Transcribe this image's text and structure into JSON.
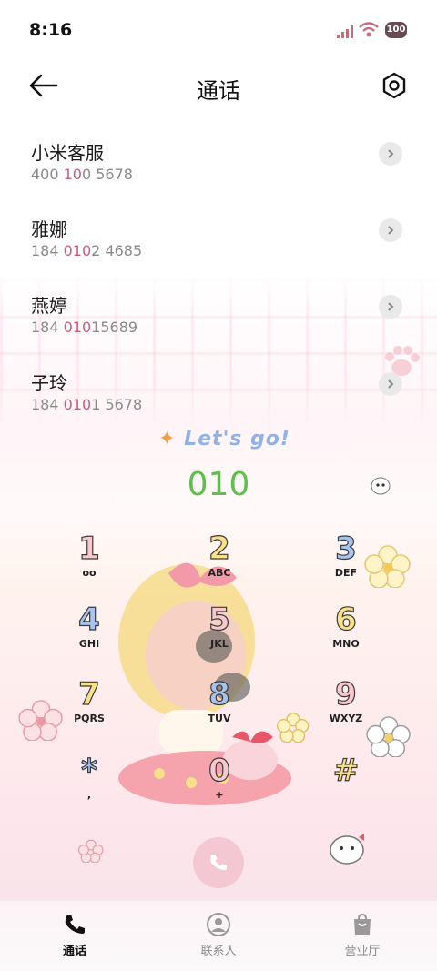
{
  "status_bar": {
    "time": "8:16",
    "battery": "100"
  },
  "header": {
    "title": "通话"
  },
  "contacts": [
    {
      "name": "小米客服",
      "num_a": "400 ",
      "num_hl": "10",
      "num_b": "0 5678"
    },
    {
      "name": "雅娜",
      "num_a": "184 ",
      "num_hl": "010",
      "num_b": "2 4685"
    },
    {
      "name": "燕婷",
      "num_a": "184 ",
      "num_hl": "010",
      "num_b": "15689"
    },
    {
      "name": "子玲",
      "num_a": "184 ",
      "num_hl": "010",
      "num_b": "1 5678"
    }
  ],
  "banner": "Let's go!",
  "dialer": {
    "input": "010"
  },
  "keypad": [
    {
      "digit": "1",
      "letters": "ᴏᴏ"
    },
    {
      "digit": "2",
      "letters": "ABC"
    },
    {
      "digit": "3",
      "letters": "DEF"
    },
    {
      "digit": "4",
      "letters": "GHI"
    },
    {
      "digit": "5",
      "letters": "JKL"
    },
    {
      "digit": "6",
      "letters": "MNO"
    },
    {
      "digit": "7",
      "letters": "PQRS"
    },
    {
      "digit": "8",
      "letters": "TUV"
    },
    {
      "digit": "9",
      "letters": "WXYZ"
    },
    {
      "digit": "*",
      "letters": ","
    },
    {
      "digit": "0",
      "letters": "+"
    },
    {
      "digit": "#",
      "letters": ""
    }
  ],
  "nav": {
    "calls": "通话",
    "contacts": "联系人",
    "store": "营业厅"
  },
  "colors": {
    "highlight": "#c0607c",
    "dial_text": "#5cc04a",
    "call_button": "#f4c8d2"
  }
}
